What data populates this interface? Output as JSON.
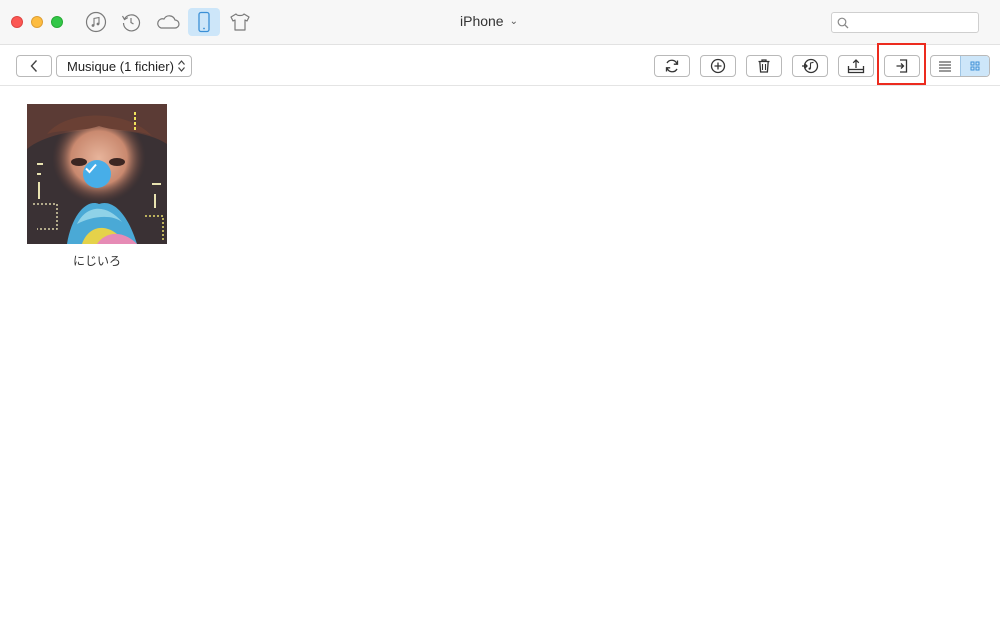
{
  "window": {
    "device_name": "iPhone"
  },
  "nav": {
    "icons": [
      "itunes-icon",
      "backup-history-icon",
      "icloud-icon",
      "iphone-icon",
      "tshirt-icon"
    ],
    "active": "iphone-icon"
  },
  "search": {
    "value": "",
    "placeholder": ""
  },
  "toolbar": {
    "category_select": "Musique (1 fichier)",
    "tools": [
      "refresh-icon",
      "add-icon",
      "trash-icon",
      "to-itunes-icon",
      "export-to-computer-icon",
      "send-to-device-icon"
    ],
    "highlighted_tool": "send-to-device-icon",
    "view_modes": [
      "list-view-icon",
      "grid-view-icon"
    ],
    "active_view": "grid-view-icon"
  },
  "content": {
    "items": [
      {
        "title": "にじいろ",
        "selected": true
      }
    ]
  },
  "colors": {
    "accent": "#47aee8",
    "active_bg": "#cde6f9",
    "highlight": "#ec2b1e"
  }
}
